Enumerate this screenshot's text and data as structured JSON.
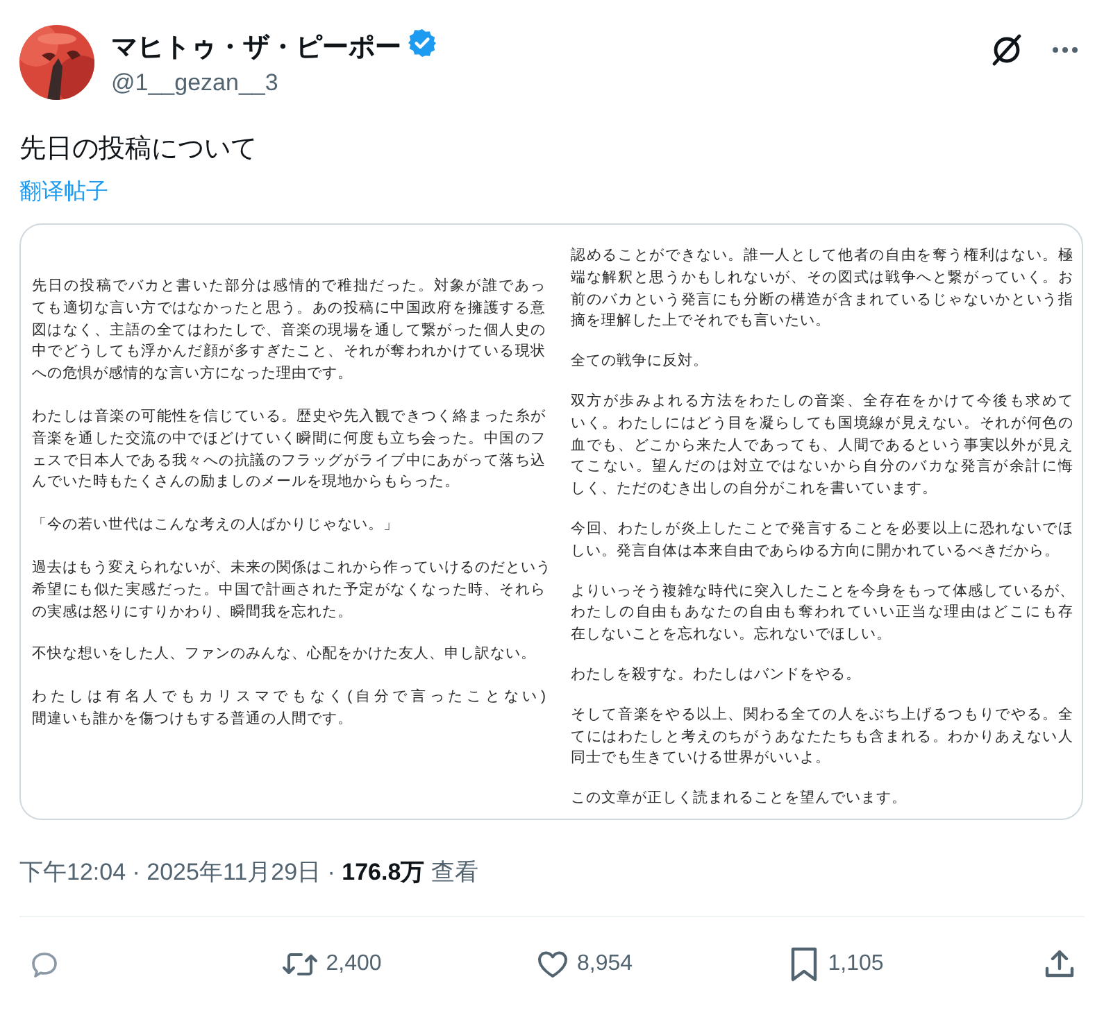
{
  "author": {
    "name": "マヒトゥ・ザ・ピーポー",
    "verified": true,
    "handle": "@1__gezan__3"
  },
  "post": {
    "text": "先日の投稿について",
    "translate_link": "翻译帖子"
  },
  "attachment": {
    "columns": [
      {
        "paragraphs": [
          [
            "先日の投稿でバカと書いた部分は感情的で稚拙だった。対象が誰であっ",
            "ても適切な言い方ではなかったと思う。あの投稿に中国政府を擁護する意",
            "図はなく、主語の全てはわたしで、音楽の現場を通して繋がった個人史の",
            "中でどうしても浮かんだ顔が多すぎたこと、それが奪われかけている現状",
            "への危惧が感情的な言い方になった理由です。"
          ],
          [
            "わたしは音楽の可能性を信じている。歴史や先入観できつく絡まった糸が",
            "音楽を通した交流の中でほどけていく瞬間に何度も立ち会った。中国のフ",
            "ェスで日本人である我々への抗議のフラッグがライブ中にあがって落ち込",
            "んでいた時もたくさんの励ましのメールを現地からもらった。"
          ],
          [
            "「今の若い世代はこんな考えの人ばかりじゃない。」"
          ],
          [
            "過去はもう変えられないが、未来の関係はこれから作っていけるのだという",
            "希望にも似た実感だった。中国で計画された予定がなくなった時、それら",
            "の実感は怒りにすりかわり、瞬間我を忘れた。"
          ],
          [
            "不快な想いをした人、ファンのみんな、心配をかけた友人、申し訳ない。"
          ],
          [
            "わたしは有名人でもカリスマでもなく(自分で言ったことない)",
            "間違いも誰かを傷つけもする普通の人間です。"
          ]
        ]
      },
      {
        "paragraphs": [
          [
            "認めることができない。誰一人として他者の自由を奪う権利はない。極",
            "端な解釈と思うかもしれないが、その図式は戦争へと繋がっていく。お",
            "前のバカという発言にも分断の構造が含まれているじゃないかという指",
            "摘を理解した上でそれでも言いたい。"
          ],
          [
            "全ての戦争に反対。"
          ],
          [
            "双方が歩みよれる方法をわたしの音楽、全存在をかけて今後も求めて",
            "いく。わたしにはどう目を凝らしても国境線が見えない。それが何色の",
            "血でも、どこから来た人であっても、人間であるという事実以外が見え",
            "てこない。望んだのは対立ではないから自分のバカな発言が余計に悔",
            "しく、ただのむき出しの自分がこれを書いています。"
          ],
          [
            "今回、わたしが炎上したことで発言することを必要以上に恐れないでほ",
            "しい。発言自体は本来自由であらゆる方向に開かれているべきだから。"
          ],
          [
            "よりいっそう複雑な時代に突入したことを今身をもって体感しているが、",
            "わたしの自由もあなたの自由も奪われていい正当な理由はどこにも存",
            "在しないことを忘れない。忘れないでほしい。"
          ],
          [
            "わたしを殺すな。わたしはバンドをやる。"
          ],
          [
            "そして音楽をやる以上、関わる全ての人をぶち上げるつもりでやる。全",
            "てにはわたしと考えのちがうあなたたちも含まれる。わかりあえない人",
            "同士でも生きていける世界がいいよ。"
          ],
          [
            "この文章が正しく読まれることを望んでいます。"
          ]
        ]
      }
    ]
  },
  "meta": "下午12:04 · 2025年11月29日 · **176.8万** 查看",
  "actions": [
    {
      "kind": "reply"
    },
    {
      "kind": "repost",
      "count": "2,400"
    },
    {
      "kind": "like",
      "count": "8,954"
    },
    {
      "kind": "bookmark",
      "count": "1,105"
    },
    {
      "kind": "share"
    }
  ]
}
